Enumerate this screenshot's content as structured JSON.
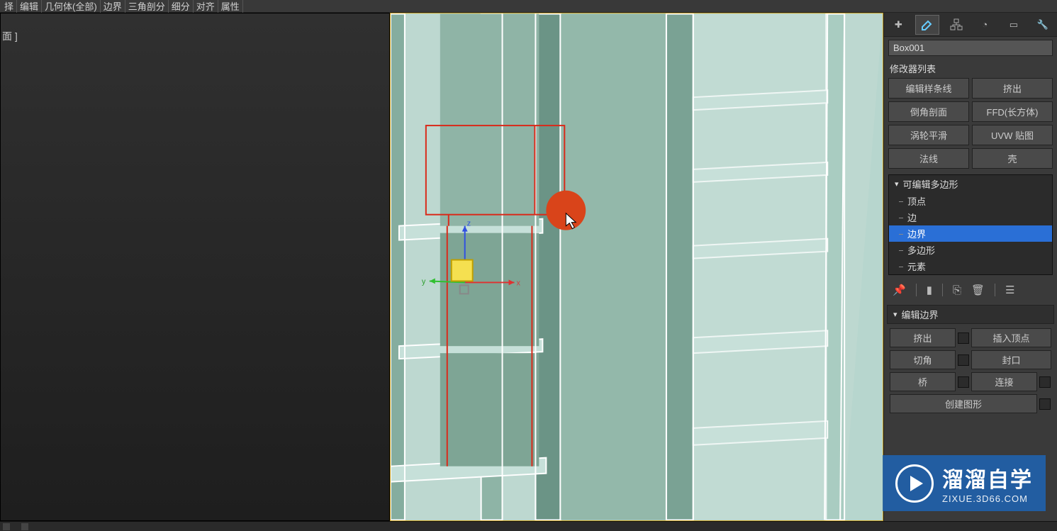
{
  "menu": [
    "择",
    "编辑",
    "几何体(全部)",
    "边界",
    "三角剖分",
    "细分",
    "对齐",
    "属性"
  ],
  "viewport_label": "面 ]",
  "object_name": "Box001",
  "modifier_list_label": "修改器列表",
  "mod_buttons": [
    "编辑样条线",
    "挤出",
    "倒角剖面",
    "FFD(长方体)",
    "涡轮平滑",
    "UVW 贴图",
    "法线",
    "壳"
  ],
  "stack": {
    "header": "可编辑多边形",
    "items": [
      "顶点",
      "边",
      "边界",
      "多边形",
      "元素"
    ],
    "selected_index": 2
  },
  "rollout": {
    "title": "编辑边界",
    "rows": [
      {
        "a": "挤出",
        "b": "插入顶点",
        "b_full": true
      },
      {
        "a": "切角",
        "b": "封口",
        "b_full": true
      },
      {
        "a": "桥",
        "b": "连接"
      },
      {
        "a": "创建图形",
        "b": ""
      }
    ]
  },
  "watermark": {
    "title": "溜溜自学",
    "url": "ZIXUE.3D66.COM"
  }
}
